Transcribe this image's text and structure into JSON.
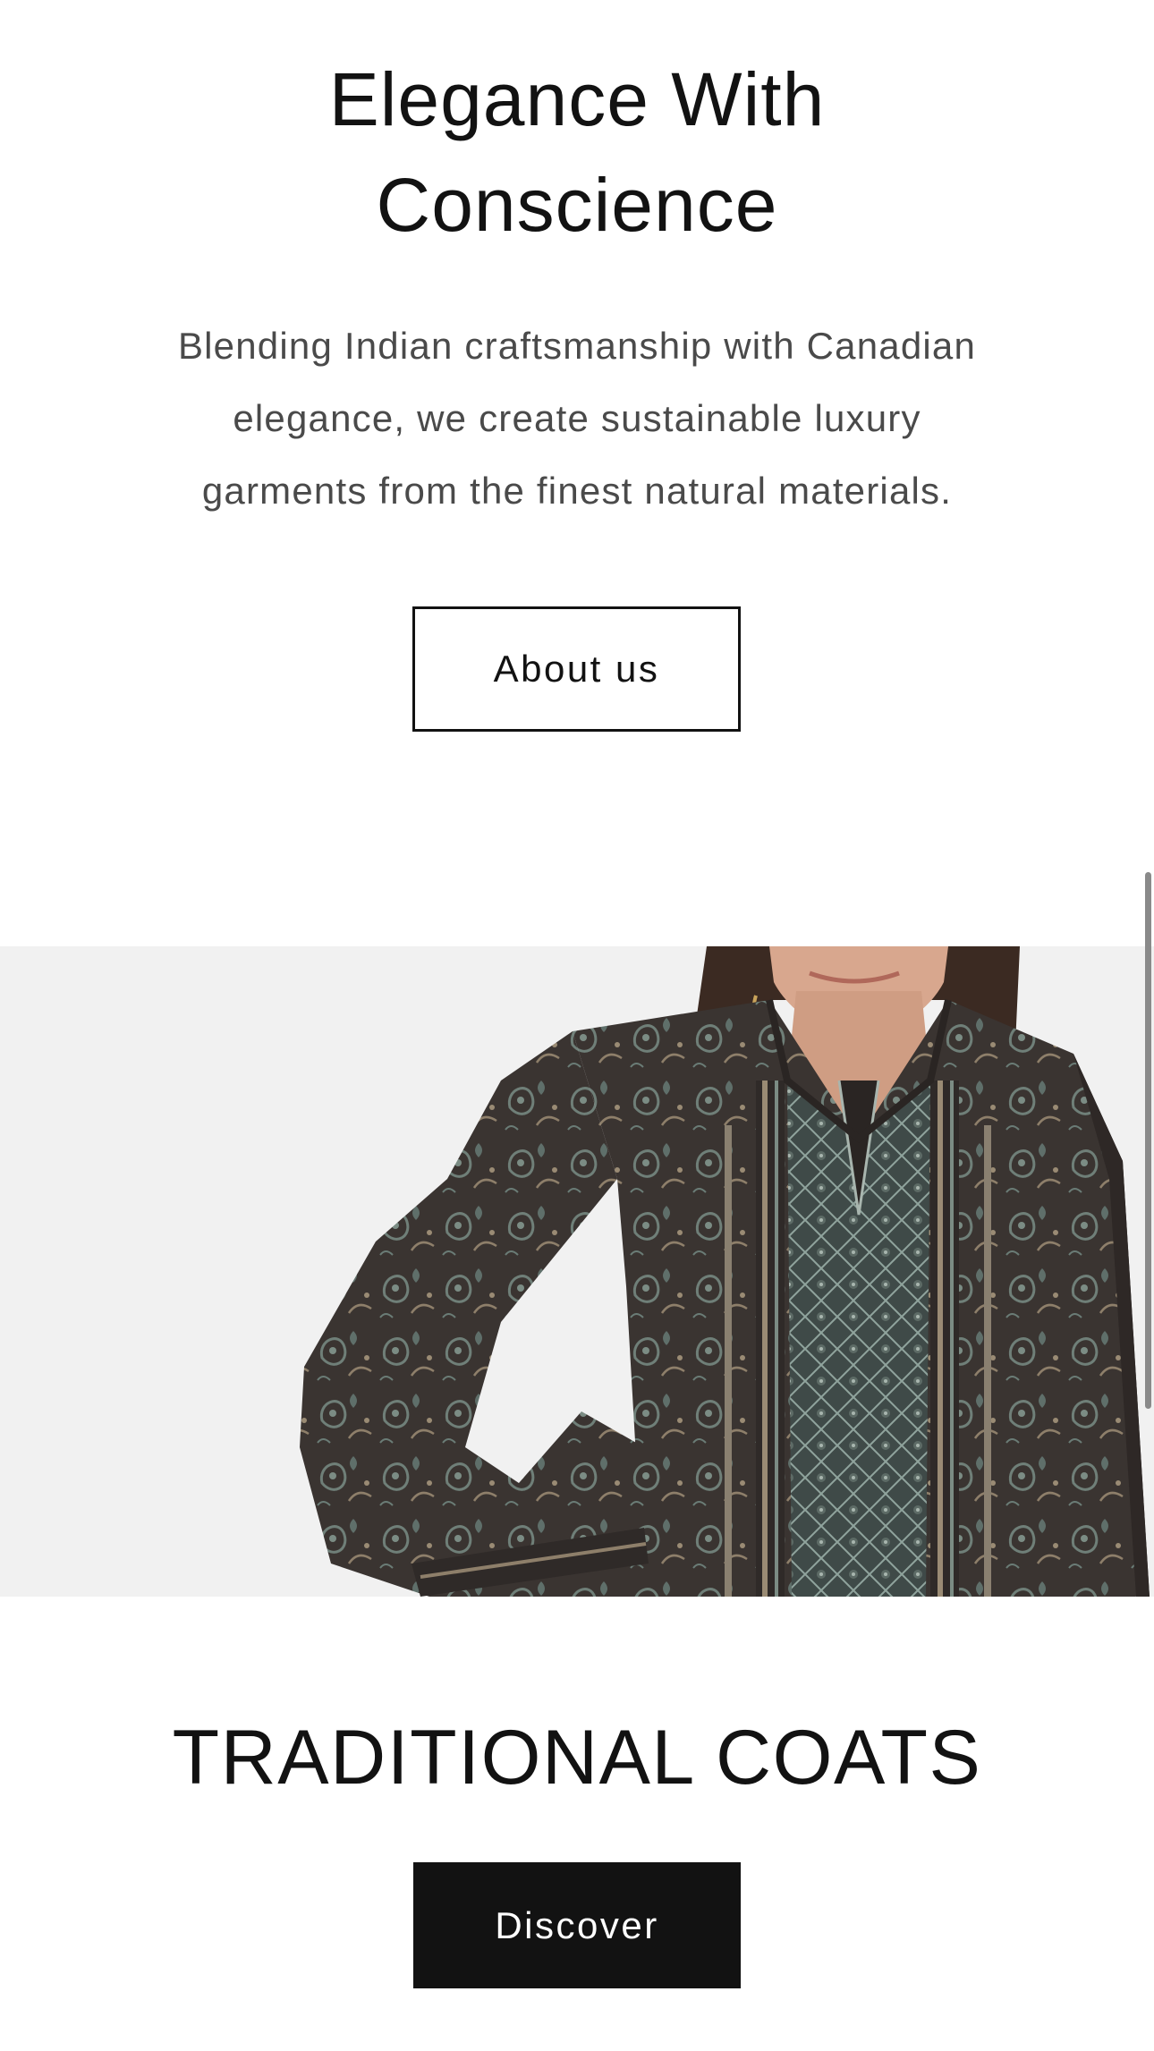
{
  "intro": {
    "title_line1": "Elegance With",
    "title_line2": "Conscience",
    "text_line1": "Blending Indian craftsmanship with Canadian",
    "text_line2": "elegance, we create sustainable luxury",
    "text_line3": "garments from the finest natural materials.",
    "button_label": "About us"
  },
  "banner": {
    "image": "woman-in-paisley-printed-traditional-coat",
    "background_color": "#f1f1f1"
  },
  "collection": {
    "title": "TRADITIONAL COATS",
    "button_label": "Discover"
  },
  "colors": {
    "text": "#121212",
    "muted_text": "#4a4a4a",
    "button_solid_bg": "#121212",
    "button_solid_text": "#ffffff"
  }
}
